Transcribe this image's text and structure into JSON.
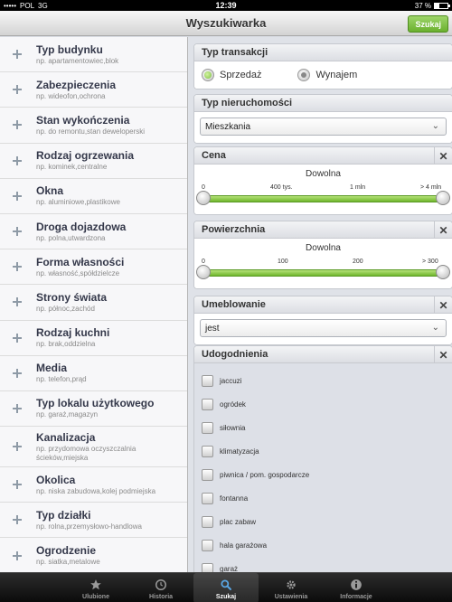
{
  "status": {
    "carrier": "POL",
    "network": "3G",
    "time": "12:39",
    "battery": "37 %",
    "battery_level": 0.37
  },
  "nav": {
    "title": "Wyszukiwarka",
    "search_button": "Szukaj"
  },
  "filters": [
    {
      "title": "Typ budynku",
      "example": "np. apartamentowiec,blok"
    },
    {
      "title": "Zabezpieczenia",
      "example": "np. wideofon,ochrona"
    },
    {
      "title": "Stan wykończenia",
      "example": "np. do remontu,stan deweloperski"
    },
    {
      "title": "Rodzaj ogrzewania",
      "example": "np. kominek,centralne"
    },
    {
      "title": "Okna",
      "example": "np. aluminiowe,plastikowe"
    },
    {
      "title": "Droga dojazdowa",
      "example": "np. polna,utwardzona"
    },
    {
      "title": "Forma własności",
      "example": "np. własność,spółdzielcze"
    },
    {
      "title": "Strony świata",
      "example": "np. północ,zachód"
    },
    {
      "title": "Rodzaj kuchni",
      "example": "np. brak,oddzielna"
    },
    {
      "title": "Media",
      "example": "np. telefon,prąd"
    },
    {
      "title": "Typ lokalu użytkowego",
      "example": "np. garaż,magazyn"
    },
    {
      "title": "Kanalizacja",
      "example": "np. przydomowa oczyszczalnia ścieków,miejska"
    },
    {
      "title": "Okolica",
      "example": "np. niska zabudowa,kolej podmiejska"
    },
    {
      "title": "Typ działki",
      "example": "np. rolna,przemysłowo-handlowa"
    },
    {
      "title": "Ogrodzenie",
      "example": "np. siatka,metalowe"
    }
  ],
  "transaction": {
    "title": "Typ transakcji",
    "options": [
      "Sprzedaż",
      "Wynajem"
    ],
    "selected": "Sprzedaż"
  },
  "property": {
    "title": "Typ nieruchomości",
    "value": "Mieszkania"
  },
  "price": {
    "title": "Cena",
    "value": "Dowolna",
    "ticks": [
      "0",
      "400 tys.",
      "1 mln",
      "> 4 mln"
    ]
  },
  "area": {
    "title": "Powierzchnia",
    "value": "Dowolna",
    "ticks": [
      "0",
      "100",
      "200",
      "> 300"
    ]
  },
  "furnishing": {
    "title": "Umeblowanie",
    "value": "jest"
  },
  "amenities": {
    "title": "Udogodnienia",
    "items": [
      "jaccuzi",
      "ogródek",
      "siłownia",
      "klimatyzacja",
      "piwnica / pom. gospodarcze",
      "fontanna",
      "plac zabaw",
      "hala garażowa",
      "garaż"
    ]
  },
  "tabs": [
    {
      "label": "Ulubione",
      "icon": "star-icon"
    },
    {
      "label": "Historia",
      "icon": "clock-icon"
    },
    {
      "label": "Szukaj",
      "icon": "search-icon"
    },
    {
      "label": "Ustawienia",
      "icon": "gear-icon"
    },
    {
      "label": "Informacje",
      "icon": "info-icon"
    }
  ],
  "active_tab": "Szukaj"
}
